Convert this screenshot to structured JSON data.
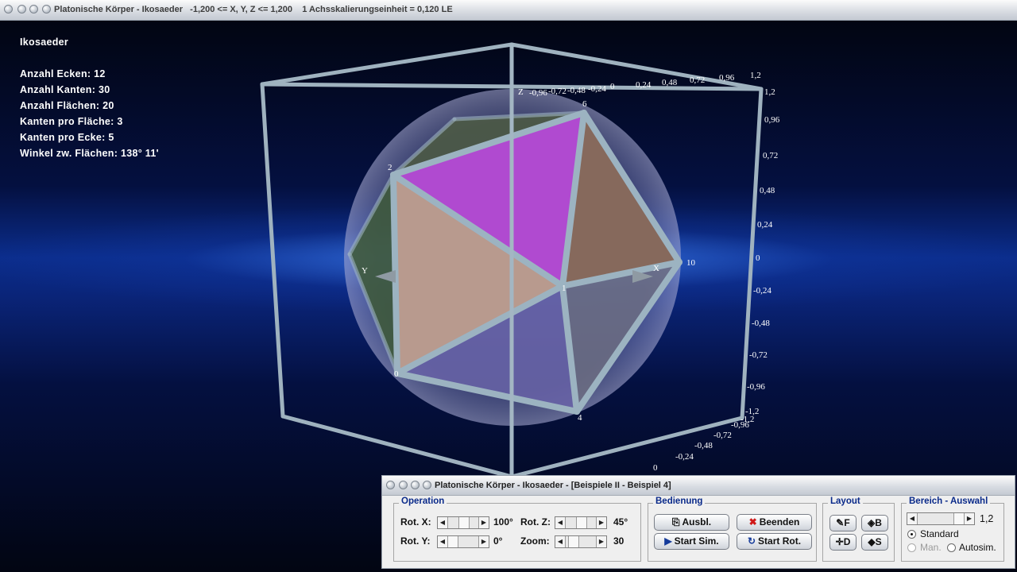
{
  "window": {
    "title": "Platonische Körper - Ikosaeder   -1,200 <= X, Y, Z <= 1,200    1 Achsskalierungseinheit = 0,120 LE"
  },
  "info": {
    "title": "Ikosaeder",
    "lines": [
      "Anzahl Ecken: 12",
      "Anzahl Kanten: 30",
      "Anzahl Flächen: 20",
      "Kanten pro Fläche: 3",
      "Kanten pro Ecke: 5",
      "Winkel zw. Flächen: 138° 11'"
    ]
  },
  "axes": {
    "x_label": "X",
    "y_label": "Y",
    "z_label": "Z",
    "top_ticks": [
      "-0,96",
      "-0,72",
      "-0,48",
      "-0,24",
      "0",
      "0,24",
      "0,48",
      "0,72",
      "0,96",
      "1,2"
    ],
    "right_ticks": [
      "1,2",
      "0,96",
      "0,72",
      "0,48",
      "0,24",
      "0",
      "-0,24",
      "-0,48",
      "-0,72",
      "-0,96",
      "-1,2"
    ],
    "diag_ticks": [
      "-1,2",
      "-0,96",
      "-0,72",
      "-0,48",
      "-0,24",
      "0"
    ],
    "vertices": [
      "6",
      "2",
      "10",
      "1",
      "0",
      "4"
    ]
  },
  "panel": {
    "title": "Platonische Körper - Ikosaeder - [Beispiele II - Beispiel 4]",
    "operation": {
      "label": "Operation",
      "rot_x_label": "Rot. X:",
      "rot_x_value": "100°",
      "rot_y_label": "Rot. Y:",
      "rot_y_value": "0°",
      "rot_z_label": "Rot. Z:",
      "rot_z_value": "45°",
      "zoom_label": "Zoom:",
      "zoom_value": "30"
    },
    "bedienung": {
      "label": "Bedienung",
      "ausbl": "Ausbl.",
      "beenden": "Beenden",
      "start_sim": "Start Sim.",
      "start_rot": "Start Rot."
    },
    "layout": {
      "label": "Layout",
      "f": "F",
      "b": "B",
      "d": "D",
      "s": "S"
    },
    "bereich": {
      "label": "Bereich - Auswahl",
      "value": "1,2",
      "standard": "Standard",
      "man": "Man.",
      "autosim": "Autosim."
    }
  }
}
